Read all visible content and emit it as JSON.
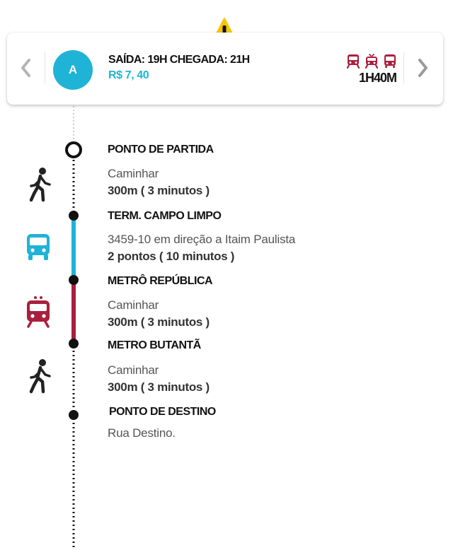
{
  "alert": {
    "icon": "warning-icon",
    "color": "#f7c600"
  },
  "route_card": {
    "option_label": "A",
    "times": "SAÍDA: 19H CHEGADA: 21H",
    "price": "R$ 7, 40",
    "duration": "1H40M",
    "mode_icons": [
      "train-icon",
      "tram-icon",
      "bus-icon"
    ],
    "accent_color": "#1fb3d6",
    "mode_color": "#a9203e"
  },
  "itinerary": {
    "stops": [
      {
        "name": "PONTO DE PARTIDA"
      },
      {
        "name": "TERM. CAMPO LIMPO"
      },
      {
        "name": "METRÔ REPÚBLICA"
      },
      {
        "name": "METRO BUTANTÃ"
      },
      {
        "name": "PONTO DE DESTINO",
        "detail": "Rua Destino."
      }
    ],
    "segments": [
      {
        "mode": "walk-icon",
        "line1": "Caminhar",
        "line2": "300m ( 3 minutos )"
      },
      {
        "mode": "bus-icon",
        "color": "#1fb3d6",
        "line1": "3459-10 em direção a Itaim Paulista",
        "line2": "2 pontos ( 10 minutos )"
      },
      {
        "mode": "train-icon",
        "color": "#a9203e",
        "line1": "Caminhar",
        "line2": "300m ( 3 minutos )"
      },
      {
        "mode": "walk-icon",
        "line1": "Caminhar",
        "line2": "300m ( 3 minutos )"
      }
    ]
  }
}
